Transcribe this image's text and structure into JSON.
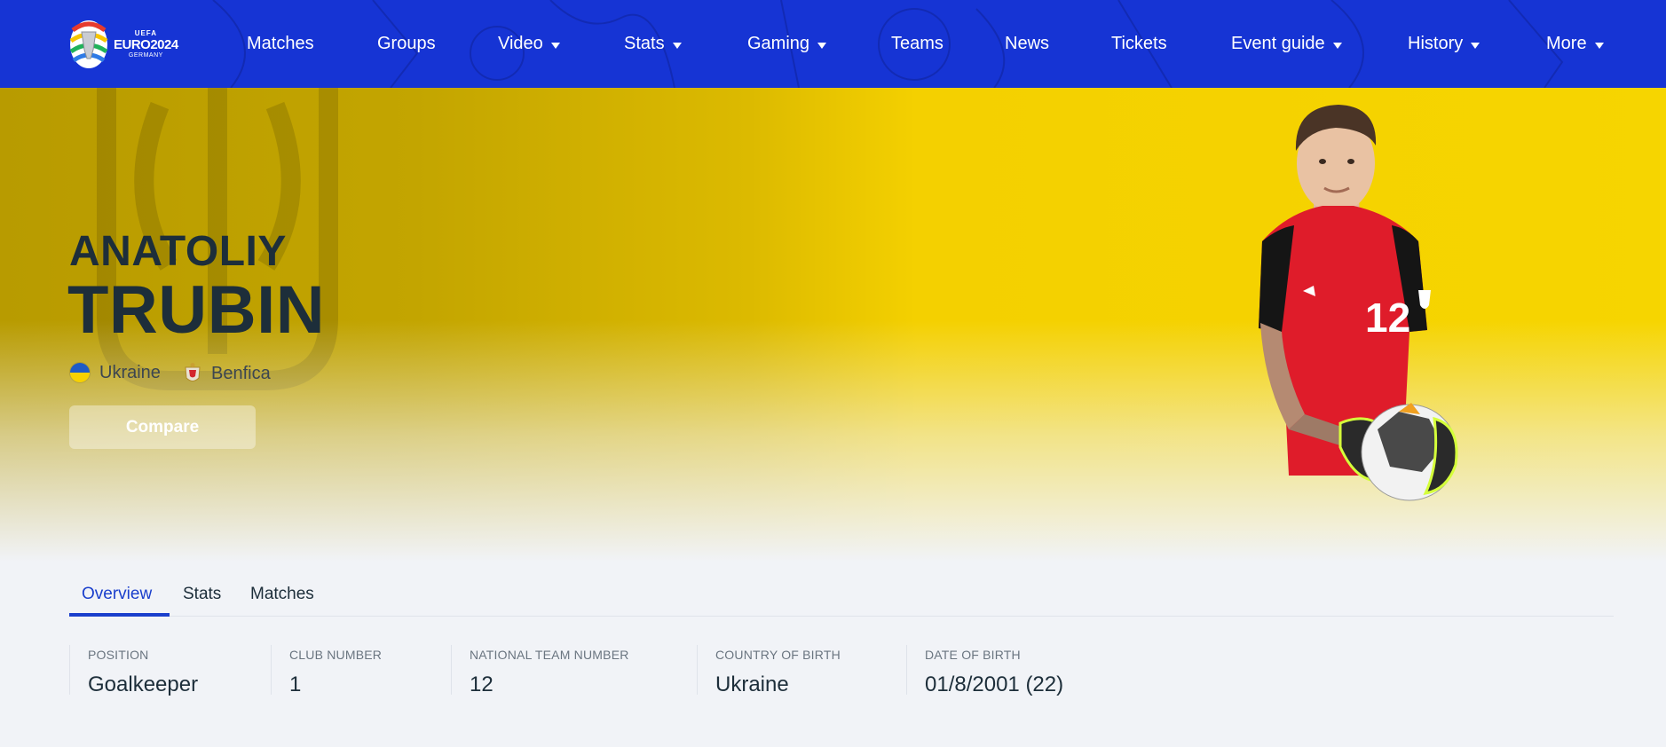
{
  "logo": {
    "uefa": "UEFA",
    "euro": "EURO2024",
    "host": "GERMANY",
    "icon": "euro2024-trophy-icon"
  },
  "nav": {
    "matches": "Matches",
    "groups": "Groups",
    "video": "Video",
    "stats": "Stats",
    "gaming": "Gaming",
    "teams": "Teams",
    "news": "News",
    "tickets": "Tickets",
    "event_guide": "Event guide",
    "history": "History",
    "more": "More"
  },
  "player": {
    "first_name": "ANATOLIY",
    "last_name": "TRUBIN",
    "country": "Ukraine",
    "club": "Benfica",
    "shirt_number": "12"
  },
  "actions": {
    "compare": "Compare"
  },
  "tabs": {
    "overview": "Overview",
    "stats": "Stats",
    "matches": "Matches"
  },
  "info": [
    {
      "label": "POSITION",
      "value": "Goalkeeper"
    },
    {
      "label": "CLUB NUMBER",
      "value": "1"
    },
    {
      "label": "NATIONAL TEAM NUMBER",
      "value": "12"
    },
    {
      "label": "COUNTRY OF BIRTH",
      "value": "Ukraine"
    },
    {
      "label": "DATE OF BIRTH",
      "value": "01/8/2001 (22)"
    }
  ],
  "colors": {
    "header": "#1634d4",
    "accent": "#1a3fcc",
    "hero_yellow": "#f6d500",
    "text_dark": "#1d2e3a"
  }
}
